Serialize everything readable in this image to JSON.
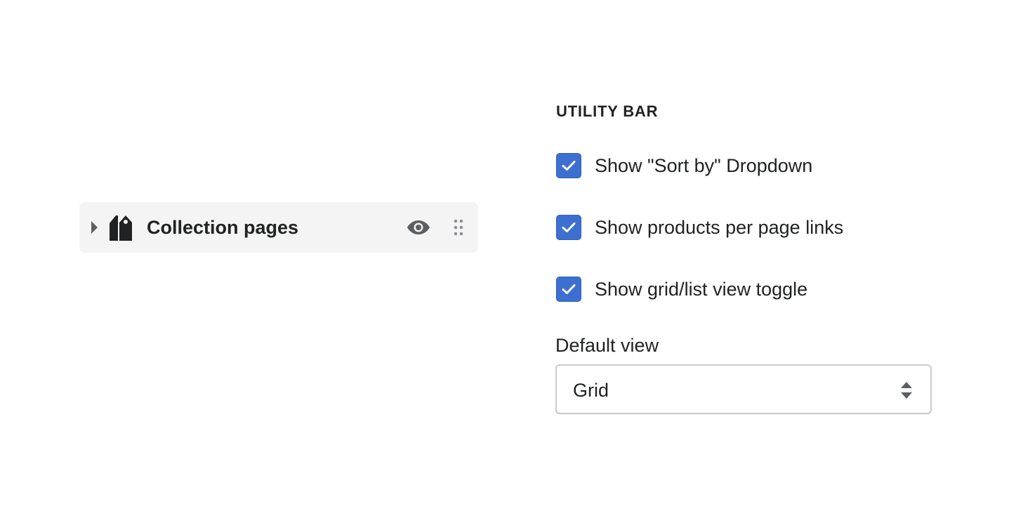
{
  "section": {
    "title": "Collection pages",
    "caret_icon": "caret-right-icon",
    "section_icon": "tags-icon",
    "visibility_icon": "eye-icon",
    "drag_icon": "drag-handle-icon",
    "background": "#f4f4f4"
  },
  "settings": {
    "heading": "UTILITY BAR",
    "checkboxes": [
      {
        "label": "Show \"Sort by\" Dropdown",
        "checked": true
      },
      {
        "label": "Show products per page links",
        "checked": true
      },
      {
        "label": "Show grid/list view toggle",
        "checked": true
      }
    ],
    "default_view": {
      "label": "Default view",
      "selected": "Grid",
      "arrows_icon": "select-arrows-icon"
    }
  },
  "colors": {
    "checkbox_checked": "#3c6fcf",
    "text": "#202223",
    "icon_gray": "#5c5f62"
  }
}
